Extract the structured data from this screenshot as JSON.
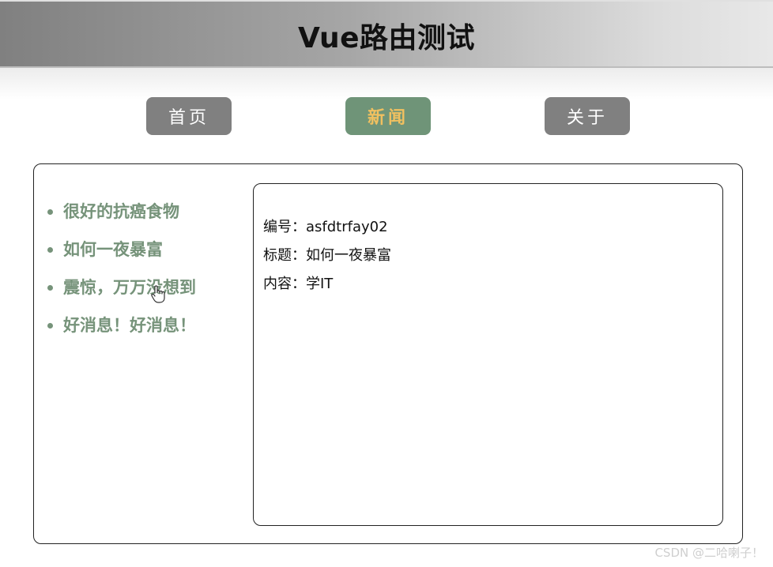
{
  "header": {
    "title": "Vue路由测试"
  },
  "nav": {
    "items": [
      {
        "label": "首页",
        "active": false
      },
      {
        "label": "新闻",
        "active": true
      },
      {
        "label": "关于",
        "active": false
      }
    ]
  },
  "news": {
    "items": [
      {
        "label": "很好的抗癌食物"
      },
      {
        "label": "如何一夜暴富"
      },
      {
        "label": "震惊，万万没想到"
      },
      {
        "label": "好消息！好消息！"
      }
    ]
  },
  "detail": {
    "id_label": "编号：",
    "id_value": "asfdtrfay02",
    "title_label": "标题：",
    "title_value": "如何一夜暴富",
    "content_label": "内容：",
    "content_value": "学IT"
  },
  "watermark": {
    "text": "CSDN @二哈喇子！"
  },
  "colors": {
    "nav_default_bg": "#808080",
    "nav_active_bg": "#6f9478",
    "nav_active_text": "#f0c060",
    "news_link": "#76937a"
  }
}
